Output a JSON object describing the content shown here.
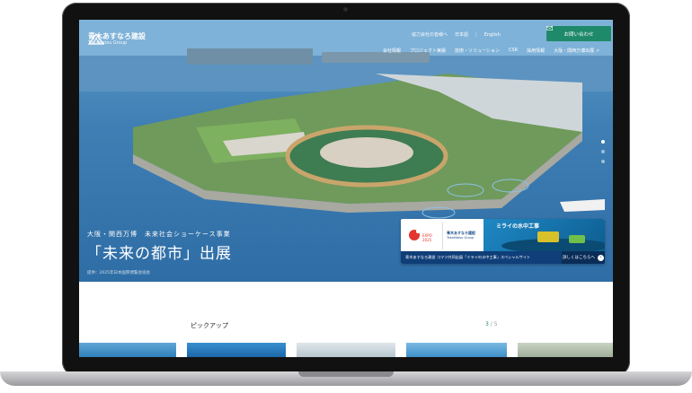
{
  "header": {
    "logo_name": "青木あすなろ建設",
    "logo_sub": "TakaMatsu Group",
    "top_links": [
      "協力会社の皆様へ",
      "日本語",
      "English"
    ],
    "lang_sep": "|",
    "contact_label": "お問い合わせ",
    "main_nav": [
      "会社情報",
      "プロジェクト実績",
      "技術・ソリューション",
      "CSR",
      "採用情報",
      "大阪・関西万博出展"
    ]
  },
  "hero": {
    "subtitle": "大阪・関西万博　未来社会ショーケース事業",
    "title": "「未来の都市」出展",
    "credit": "提供：2025年日本国際博覧会協会",
    "slides_total": 3,
    "slide_active": 1
  },
  "banner": {
    "logo_expo": "EXPO 2025",
    "logo_company": "青木あすなろ建設",
    "logo_company_sub": "TakaMatsu Group",
    "image_title": "ミライの水中工事",
    "strip_text": "青木あすなろ建設 コマツ共同出展「ミライの水中工事」スペシャルサイト",
    "more_label": "詳しくはこちらへ",
    "more_arrow": "›"
  },
  "pickup": {
    "heading": "ピックアップ",
    "page_current": "3",
    "page_sep": "/",
    "page_total": "5"
  },
  "icons": {
    "mail": "mail-icon",
    "external": "external-link-icon"
  },
  "colors": {
    "accent_green": "#1f8a6a",
    "banner_navy": "#0f3e78"
  }
}
